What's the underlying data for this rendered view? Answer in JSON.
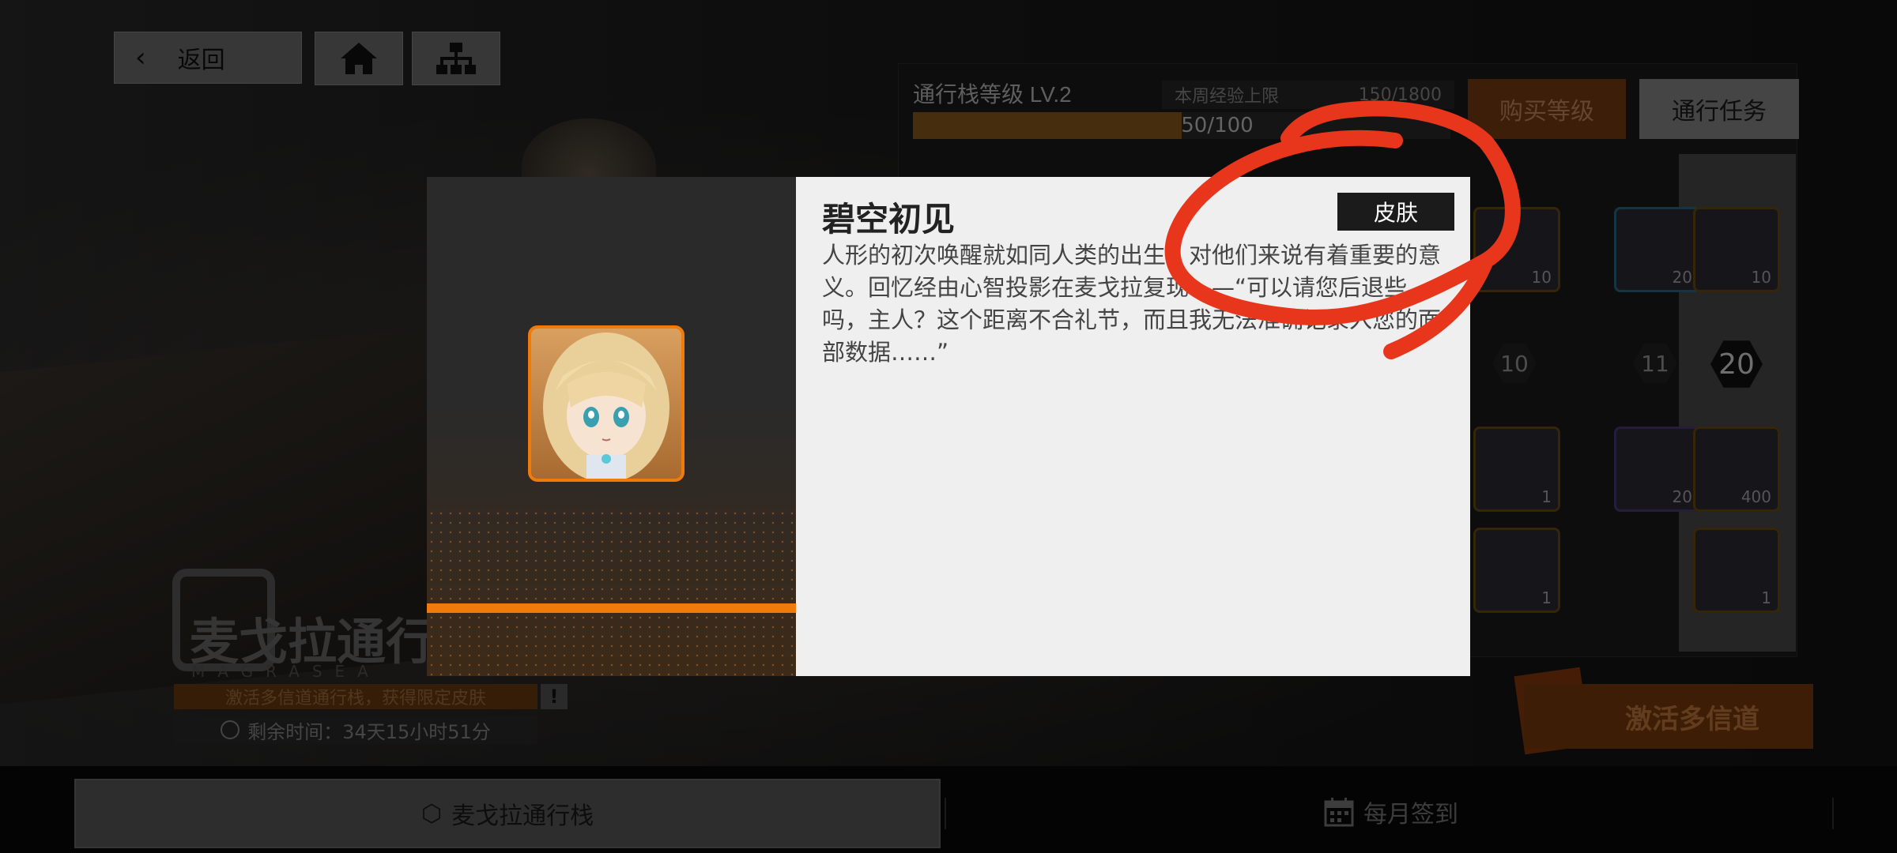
{
  "nav": {
    "back_label": "返回",
    "home_icon": "home-icon",
    "tree_icon": "sitemap-icon"
  },
  "pass": {
    "level_label": "通行栈等级 LV.2",
    "exp_current": "50/100",
    "exp_fraction": 0.5,
    "week_cap_label": "本周经验上限",
    "week_cap_value": "150/1800",
    "buy_level_label": "购买等级",
    "pass_tasks_label": "通行任务",
    "level_markers": [
      "10",
      "11",
      "20"
    ],
    "reward_counts": [
      "10",
      "20",
      "10",
      "1",
      "20",
      "400",
      "1",
      "1"
    ],
    "activate_label": "激活多信道",
    "accent_color": "#f07a0a"
  },
  "brand": {
    "title": "麦戈拉通行",
    "subtitle": "MAGRASEA",
    "promo": "激活多信道通行栈，获得限定皮肤",
    "promo_mark": "!",
    "timer": "剩余时间：34天15小时51分"
  },
  "modal": {
    "title": "碧空初见",
    "badge": "皮肤",
    "description": "人形的初次唤醒就如同人类的出生，对他们来说有着重要的意义。回忆经由心智投影在麦戈拉复现——“可以请您后退些吗，主人？这个距离不合礼节，而且我无法准确记录入您的面部数据……”"
  },
  "tabs": [
    {
      "label": "麦戈拉通行栈",
      "icon": "pass-logo-icon"
    },
    {
      "label": "每月签到",
      "icon": "calendar-icon"
    }
  ],
  "annotation_color": "#e8361c"
}
